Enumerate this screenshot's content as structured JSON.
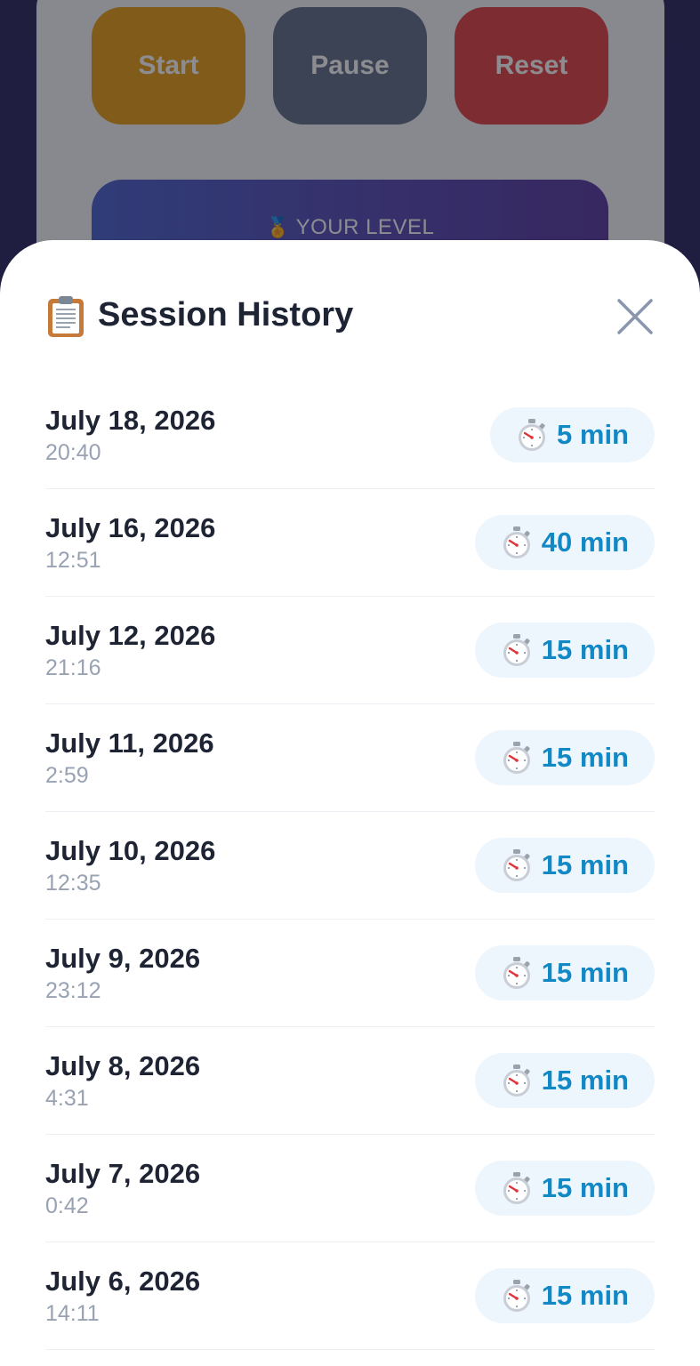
{
  "controls": {
    "start_label": "Start",
    "pause_label": "Pause",
    "reset_label": "Reset"
  },
  "level_card": {
    "label": "YOUR LEVEL",
    "icon": "medal-icon"
  },
  "sheet": {
    "title": "Session History",
    "title_icon": "clipboard-icon",
    "close_icon": "close-icon",
    "sessions": [
      {
        "date": "July 18, 2026",
        "time": "20:40",
        "duration": "5 min"
      },
      {
        "date": "July 16, 2026",
        "time": "12:51",
        "duration": "40 min"
      },
      {
        "date": "July 12, 2026",
        "time": "21:16",
        "duration": "15 min"
      },
      {
        "date": "July 11, 2026",
        "time": "2:59",
        "duration": "15 min"
      },
      {
        "date": "July 10, 2026",
        "time": "12:35",
        "duration": "15 min"
      },
      {
        "date": "July 9, 2026",
        "time": "23:12",
        "duration": "15 min"
      },
      {
        "date": "July 8, 2026",
        "time": "4:31",
        "duration": "15 min"
      },
      {
        "date": "July 7, 2026",
        "time": "0:42",
        "duration": "15 min"
      },
      {
        "date": "July 6, 2026",
        "time": "14:11",
        "duration": "15 min"
      }
    ],
    "duration_icon": "stopwatch-icon"
  },
  "colors": {
    "accent": "#1288c4",
    "badge_bg": "#eef6fd",
    "start": "#e8a11a",
    "pause": "#64748b",
    "reset": "#e24a4a"
  }
}
